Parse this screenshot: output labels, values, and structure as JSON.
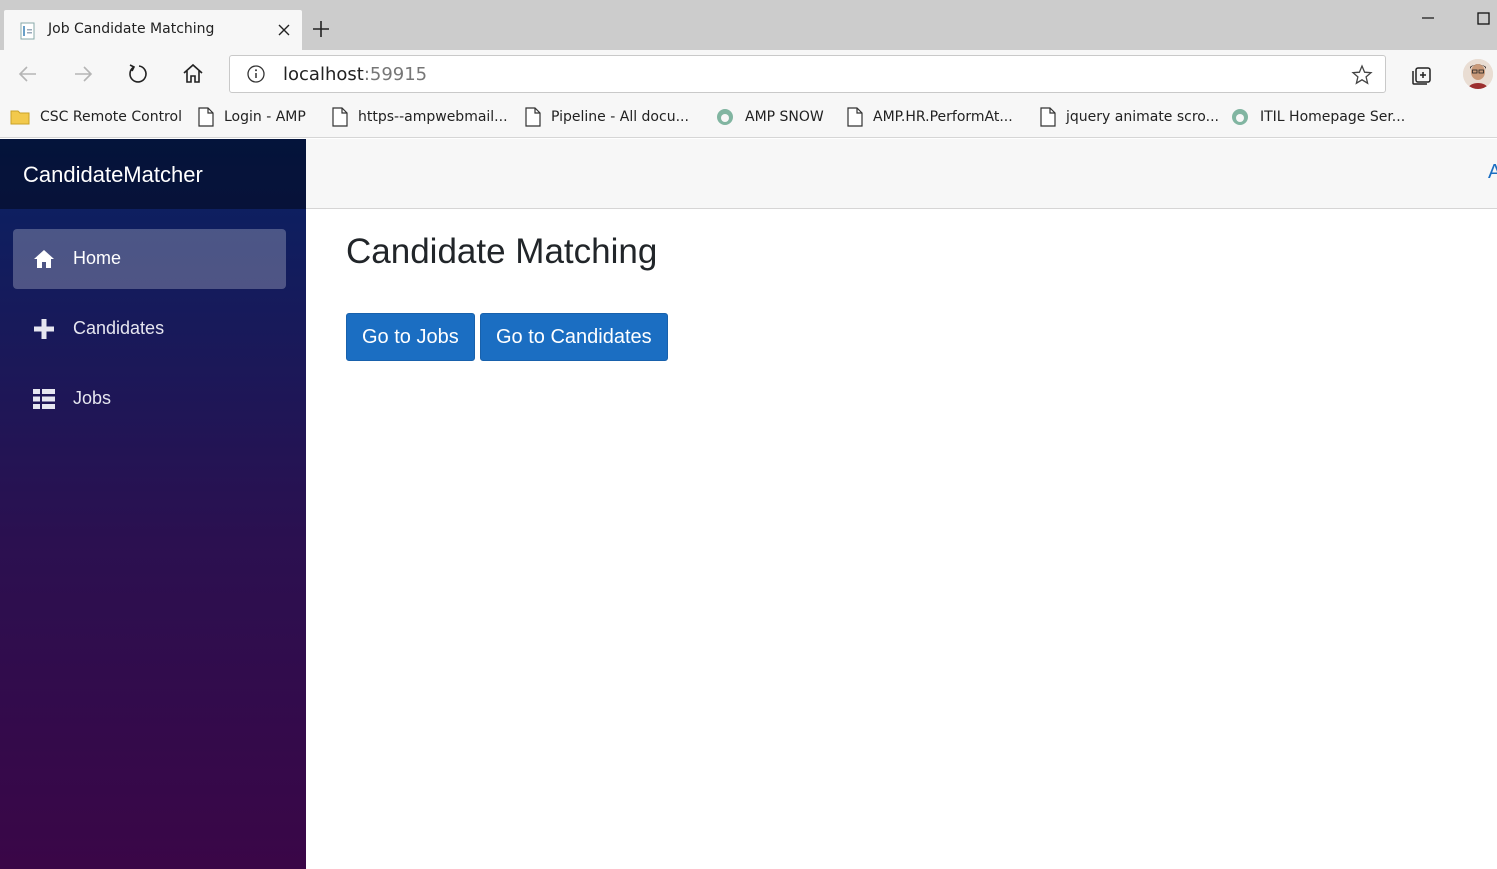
{
  "browser": {
    "tab_title": "Job Candidate Matching",
    "url_host": "localhost",
    "url_port": ":59915",
    "bookmarks": [
      {
        "label": "CSC Remote Control",
        "icon": "folder-icon"
      },
      {
        "label": "Login - AMP",
        "icon": "page-icon"
      },
      {
        "label": "https--ampwebmail...",
        "icon": "page-icon"
      },
      {
        "label": "Pipeline - All docu...",
        "icon": "page-icon"
      },
      {
        "label": "AMP SNOW",
        "icon": "servicenow-icon"
      },
      {
        "label": "AMP.HR.PerformAt...",
        "icon": "page-icon"
      },
      {
        "label": "jquery animate scro...",
        "icon": "page-icon"
      },
      {
        "label": "ITIL Homepage  Ser...",
        "icon": "servicenow-icon"
      }
    ]
  },
  "app": {
    "brand": "CandidateMatcher",
    "nav": [
      {
        "label": "Home",
        "icon": "home-icon",
        "active": true
      },
      {
        "label": "Candidates",
        "icon": "plus-icon",
        "active": false
      },
      {
        "label": "Jobs",
        "icon": "list-icon",
        "active": false
      }
    ],
    "topbar_link": "About",
    "page_title": "Candidate Matching",
    "buttons": {
      "jobs": "Go to Jobs",
      "candidates": "Go to Candidates"
    },
    "colors": {
      "primary": "#1b6ec2",
      "sidebar_top": "#072263",
      "sidebar_bottom": "#3a0647"
    }
  }
}
